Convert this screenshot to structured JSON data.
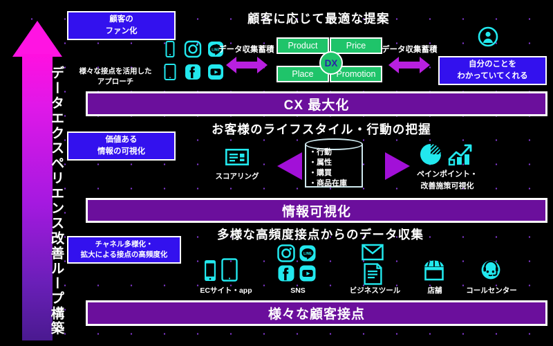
{
  "colors": {
    "background": "#000000",
    "dot_grid": "#8a3bdc",
    "arrow_magenta": "#ff14e2",
    "arrow_purple_end": "#4a1a90",
    "blue_box": "#3311ee",
    "purple_bar": "#6b0f9c",
    "green_4p": "#1fc46a",
    "cyan_icon": "#22e8ee",
    "dx_text": "#2a1fa8",
    "border_white": "#ffffff"
  },
  "left_arrow": {
    "label": "データエクスペリエンス改善ループ構築",
    "direction": "up"
  },
  "tier_top": {
    "heading": "顧客に応じて最適な提案",
    "left_box": {
      "line1": "顧客の",
      "line2": "ファン化"
    },
    "touchpoint_caption": {
      "line1": "様々な接点を活用した",
      "line2": "アプローチ"
    },
    "touchpoint_icons": [
      "smartphone-icon",
      "instagram-icon",
      "line-icon",
      "tablet-icon",
      "facebook-icon",
      "youtube-icon"
    ],
    "arrow_label_left": "データ収集蓄積",
    "arrow_label_right": "データ収集蓄積",
    "four_p": [
      "Product",
      "Price",
      "Place",
      "Promotion"
    ],
    "dx_label": "DX",
    "person_icon": "person-avatar-icon",
    "right_box": {
      "line1": "自分のことを",
      "line2": "わかっていてくれる"
    },
    "bar_label": "CX 最大化"
  },
  "tier_middle": {
    "heading": "お客様のライフスタイル・行動の把握",
    "left_box": {
      "line1": "価値ある",
      "line2": "情報の可視化"
    },
    "scoring": {
      "icon": "scorecard-icon",
      "label": "スコアリング"
    },
    "database": {
      "icon": "database-cylinder-icon",
      "items": [
        "・行動",
        "・属性",
        "・購買",
        "・商品在庫"
      ]
    },
    "painpoint": {
      "icons": [
        "pie-chart-icon",
        "bar-chart-trend-icon"
      ],
      "line1": "ペインポイント・",
      "line2": "改善施策可視化"
    },
    "bar_label": "情報可視化"
  },
  "tier_bottom": {
    "heading": "多様な高頻度接点からのデータ収集",
    "left_box": {
      "line1": "チャネル多様化・",
      "line2": "拡大による接点の高頻度化"
    },
    "channels": [
      {
        "label": "ECサイト・app",
        "icons": [
          "smartphone-icon",
          "tablet-icon"
        ]
      },
      {
        "label": "SNS",
        "icons": [
          "instagram-icon",
          "line-icon",
          "facebook-icon",
          "youtube-icon"
        ]
      },
      {
        "label": "ビジネスツール",
        "icons": [
          "mail-envelope-icon",
          "document-icon"
        ]
      },
      {
        "label": "店舗",
        "icons": [
          "storefront-icon"
        ]
      },
      {
        "label": "コールセンター",
        "icons": [
          "headset-operator-icon"
        ]
      }
    ],
    "bar_label": "様々な顧客接点"
  }
}
